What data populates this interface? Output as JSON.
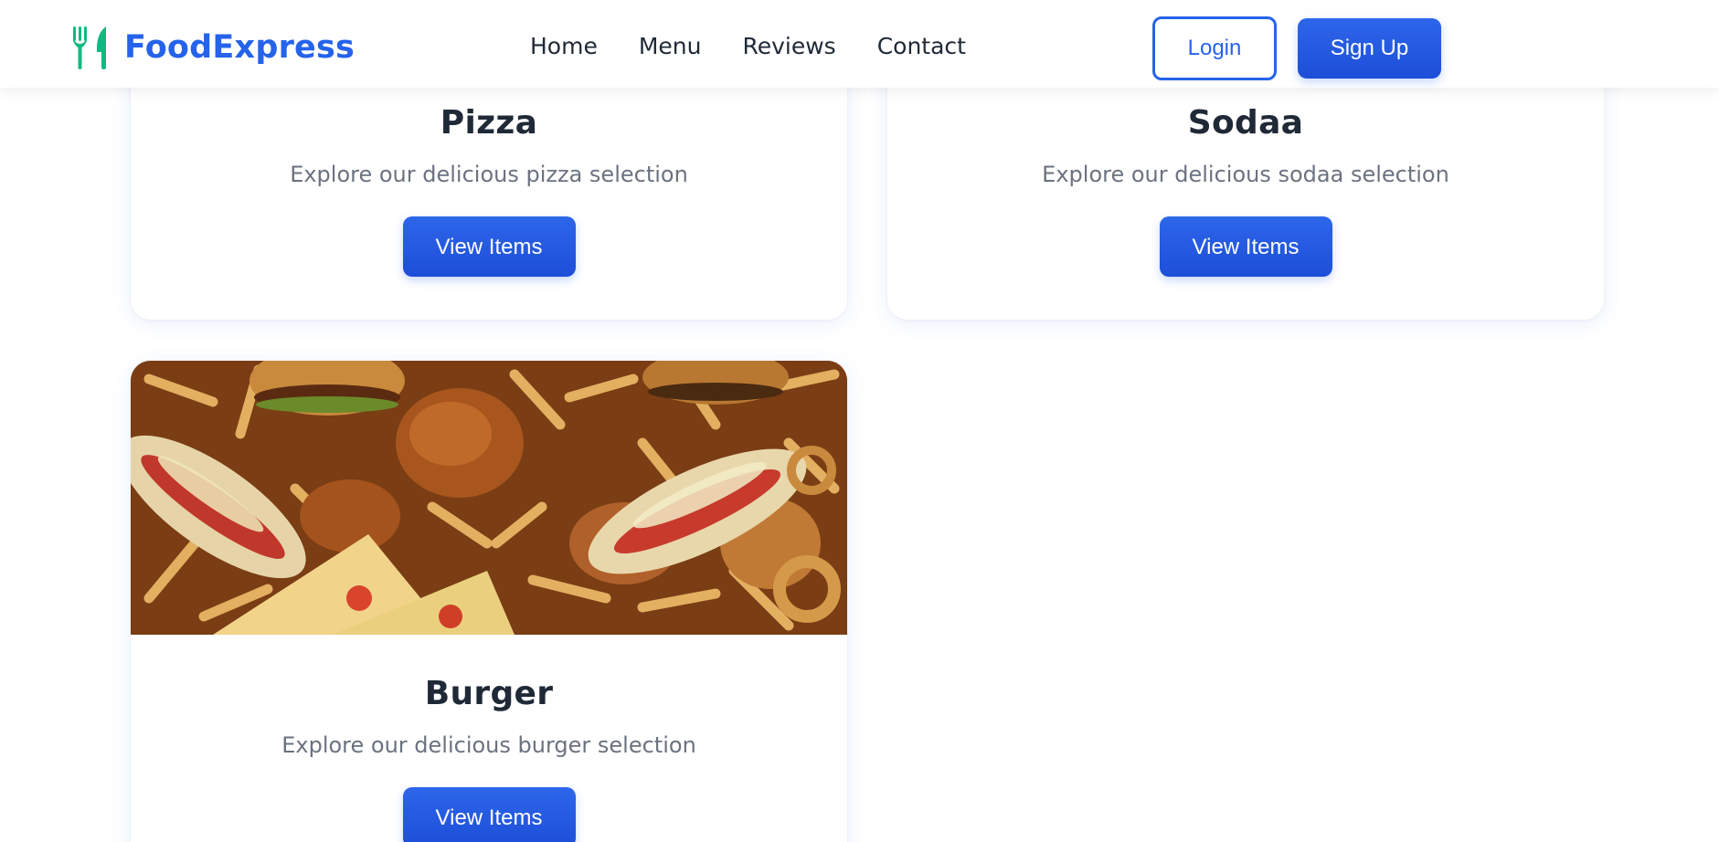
{
  "brand": {
    "name": "FoodExpress",
    "icon": "utensils-icon",
    "logo_color": "#2563eb",
    "icon_color": "#10b981"
  },
  "nav": {
    "items": [
      "Home",
      "Menu",
      "Reviews",
      "Contact"
    ]
  },
  "auth": {
    "login_label": "Login",
    "signup_label": "Sign Up"
  },
  "colors": {
    "primary": "#2563eb",
    "title": "#1f2937",
    "muted": "#6b7280"
  },
  "categories": [
    {
      "title": "Pizza",
      "description": "Explore our delicious pizza selection",
      "button_label": "View Items"
    },
    {
      "title": "Sodaa",
      "description": "Explore our delicious sodaa selection",
      "button_label": "View Items"
    },
    {
      "title": "Burger",
      "description": "Explore our delicious burger selection",
      "button_label": "View Items"
    }
  ]
}
